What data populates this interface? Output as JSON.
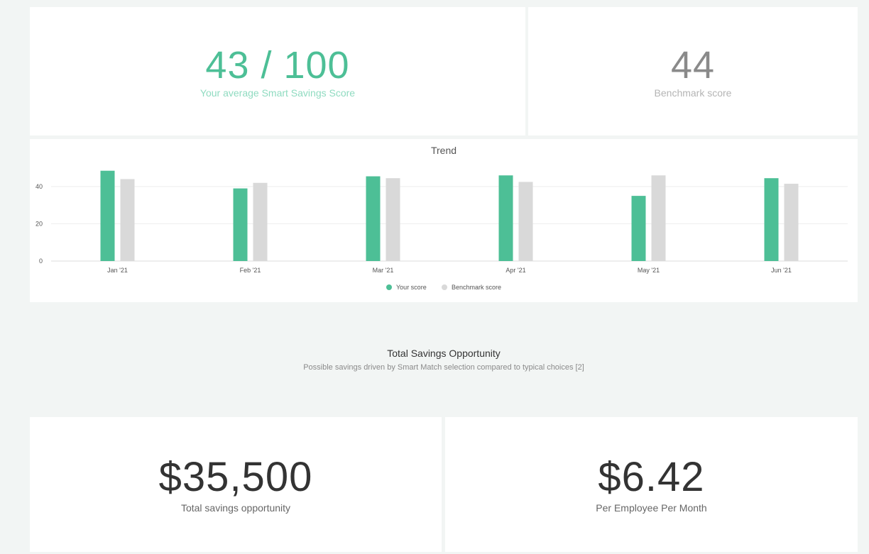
{
  "score_card": {
    "value": "43 / 100",
    "label": "Your average Smart Savings Score"
  },
  "benchmark_card": {
    "value": "44",
    "label": "Benchmark score"
  },
  "chart_data": {
    "type": "bar",
    "title": "Trend",
    "categories": [
      "Jan '21",
      "Feb '21",
      "Mar '21",
      "Apr '21",
      "May '21",
      "Jun '21"
    ],
    "series": [
      {
        "name": "Your score",
        "values": [
          48.5,
          39,
          45.5,
          46,
          35,
          44.5
        ],
        "color": "#4dbf96"
      },
      {
        "name": "Benchmark score",
        "values": [
          44,
          42,
          44.5,
          42.5,
          46,
          41.5
        ],
        "color": "#d9d9d9"
      }
    ],
    "y_ticks": [
      0,
      20,
      40
    ],
    "ylim": [
      0,
      48.5
    ],
    "grid": true,
    "legend_position": "bottom"
  },
  "opportunity": {
    "title": "Total Savings Opportunity",
    "subtitle": "Possible savings driven by Smart Match selection compared to typical choices [2]"
  },
  "total_card": {
    "value": "$35,500",
    "label": "Total savings opportunity"
  },
  "pepm_card": {
    "value": "$6.42",
    "label": "Per Employee Per Month"
  }
}
